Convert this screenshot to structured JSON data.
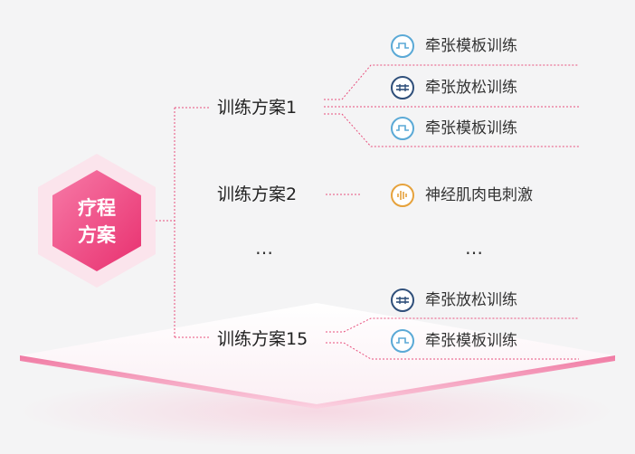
{
  "root": {
    "line1": "疗程",
    "line2": "方案",
    "icon": "hexagon-badge"
  },
  "plans": [
    {
      "label": "训练方案1",
      "exercises": [
        {
          "label": "牵张模板训练",
          "icon": "board-wave-icon"
        },
        {
          "label": "牵张放松训练",
          "icon": "relax-icon"
        },
        {
          "label": "牵张模板训练",
          "icon": "board-wave-icon"
        }
      ]
    },
    {
      "label": "训练方案2",
      "exercises": [
        {
          "label": "神经肌肉电刺激",
          "icon": "nerve-stimulation-icon"
        }
      ]
    },
    {
      "label": "训练方案15",
      "exercises": [
        {
          "label": "牵张放松训练",
          "icon": "relax-icon"
        },
        {
          "label": "牵张模板训练",
          "icon": "board-wave-icon"
        }
      ]
    }
  ],
  "ellipsis": {
    "plans": "…",
    "exercises": "…"
  },
  "colors": {
    "hexagon": "#f0508a",
    "dashed_line": "#e8507d",
    "board_icon": "#5aa9d6",
    "relax_icon": "#2f4f7a",
    "nerve_icon": "#e6a23c",
    "background": "#f4f4f5"
  }
}
